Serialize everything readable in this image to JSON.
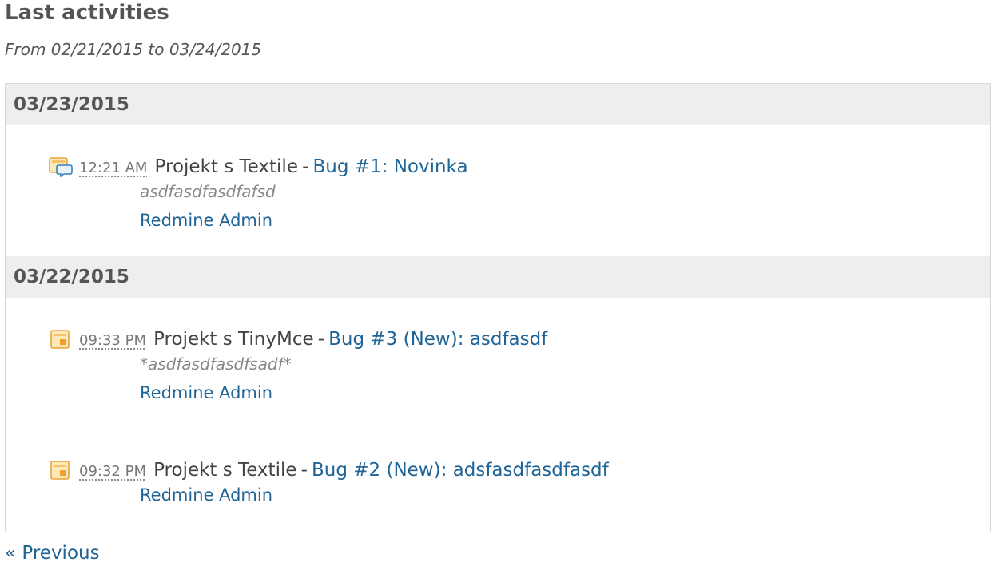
{
  "page": {
    "title": "Last activities",
    "subtitle": "From 02/21/2015 to 03/24/2015"
  },
  "days": [
    {
      "date": "03/23/2015",
      "entries": [
        {
          "icon": "issue-note-icon",
          "time": "12:21 AM",
          "project": "Projekt s Textile",
          "separator": "-",
          "link": "Bug #1: Novinka",
          "description": "asdfasdfasdfafsd",
          "author": "Redmine Admin"
        }
      ]
    },
    {
      "date": "03/22/2015",
      "entries": [
        {
          "icon": "issue-icon",
          "time": "09:33 PM",
          "project": "Projekt s TinyMce",
          "separator": "-",
          "link": "Bug #3 (New): asdfasdf",
          "description": "*asdfasdfasdfsadf*",
          "author": "Redmine Admin"
        },
        {
          "icon": "issue-icon",
          "time": "09:32 PM",
          "project": "Projekt s Textile",
          "separator": "-",
          "link": "Bug #2 (New): adsfasdfasdfasdf",
          "author": "Redmine Admin"
        }
      ]
    }
  ],
  "pagination": {
    "previous_label": "« Previous"
  },
  "colors": {
    "link": "#1f6496",
    "header_bg": "#eeeeee",
    "title": "#555555",
    "icon_orange": "#f0a030",
    "icon_blue": "#3a7fc1"
  }
}
